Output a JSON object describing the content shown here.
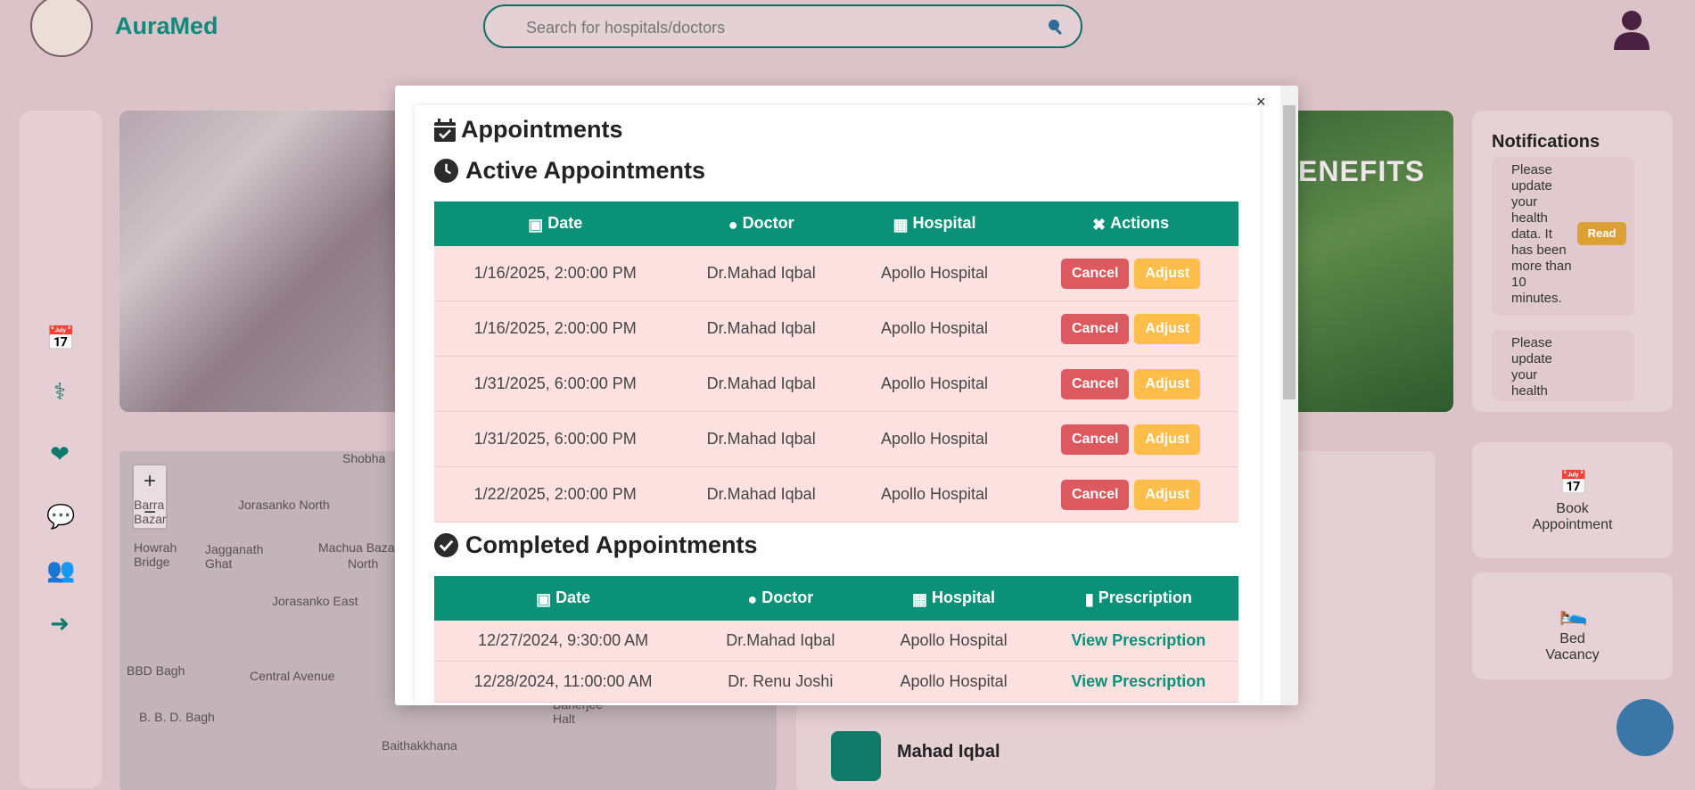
{
  "app": {
    "brand": "AuraMed"
  },
  "search": {
    "placeholder": "Search for hospitals/doctors"
  },
  "sidebar": {
    "items": [
      "calendar-icon",
      "stethoscope-icon",
      "heart-icon",
      "chat-icon",
      "users-icon",
      "logout-icon"
    ]
  },
  "hero": {
    "right_text": "ENEFITS"
  },
  "notifications": {
    "title": "Notifications",
    "items": [
      {
        "text": "Please update your health data. It has been more than 10 minutes.",
        "action": "Read"
      },
      {
        "text": "Please update your health"
      }
    ]
  },
  "map": {
    "zoom_in": "+",
    "zoom_out": "−",
    "labels": [
      "Shobha",
      "Jorasanko North",
      "Howrah Bridge",
      "Jagganath Ghat",
      "Machua Bazar",
      "North",
      "Jorasanko East",
      "BBD Bagh",
      "Central Avenue",
      "B. B. D. Bagh",
      "Baithakkhana",
      "Barra Bazar",
      "Banerjee Halt"
    ]
  },
  "doctor_list": {
    "name": "Mahad Iqbal"
  },
  "quick_actions": [
    {
      "label": "Book Appointment",
      "icon": "calendar-plus-icon"
    },
    {
      "label": "Bed Vacancy",
      "icon": "bed-icon"
    }
  ],
  "modal": {
    "close": "×",
    "title": "Appointments",
    "active": {
      "title": "Active Appointments",
      "headers": [
        "Date",
        "Doctor",
        "Hospital",
        "Actions"
      ],
      "cancel_label": "Cancel",
      "adjust_label": "Adjust",
      "rows": [
        {
          "date": "1/16/2025, 2:00:00 PM",
          "doctor": "Dr.Mahad Iqbal",
          "hospital": "Apollo Hospital"
        },
        {
          "date": "1/16/2025, 2:00:00 PM",
          "doctor": "Dr.Mahad Iqbal",
          "hospital": "Apollo Hospital"
        },
        {
          "date": "1/31/2025, 6:00:00 PM",
          "doctor": "Dr.Mahad Iqbal",
          "hospital": "Apollo Hospital"
        },
        {
          "date": "1/31/2025, 6:00:00 PM",
          "doctor": "Dr.Mahad Iqbal",
          "hospital": "Apollo Hospital"
        },
        {
          "date": "1/22/2025, 2:00:00 PM",
          "doctor": "Dr.Mahad Iqbal",
          "hospital": "Apollo Hospital"
        }
      ]
    },
    "completed": {
      "title": "Completed Appointments",
      "headers": [
        "Date",
        "Doctor",
        "Hospital",
        "Prescription"
      ],
      "rows": [
        {
          "date": "12/27/2024, 9:30:00 AM",
          "doctor": "Dr.Mahad Iqbal",
          "hospital": "Apollo Hospital",
          "link": "View Prescription"
        },
        {
          "date": "12/28/2024, 11:00:00 AM",
          "doctor": "Dr. Renu Joshi",
          "hospital": "Apollo Hospital",
          "link": "View Prescription"
        }
      ]
    }
  },
  "colors": {
    "accent": "#0b9178",
    "cancel": "#dc5a5f",
    "adjust": "#fdbd4b",
    "row_bg": "#fde1e1"
  }
}
